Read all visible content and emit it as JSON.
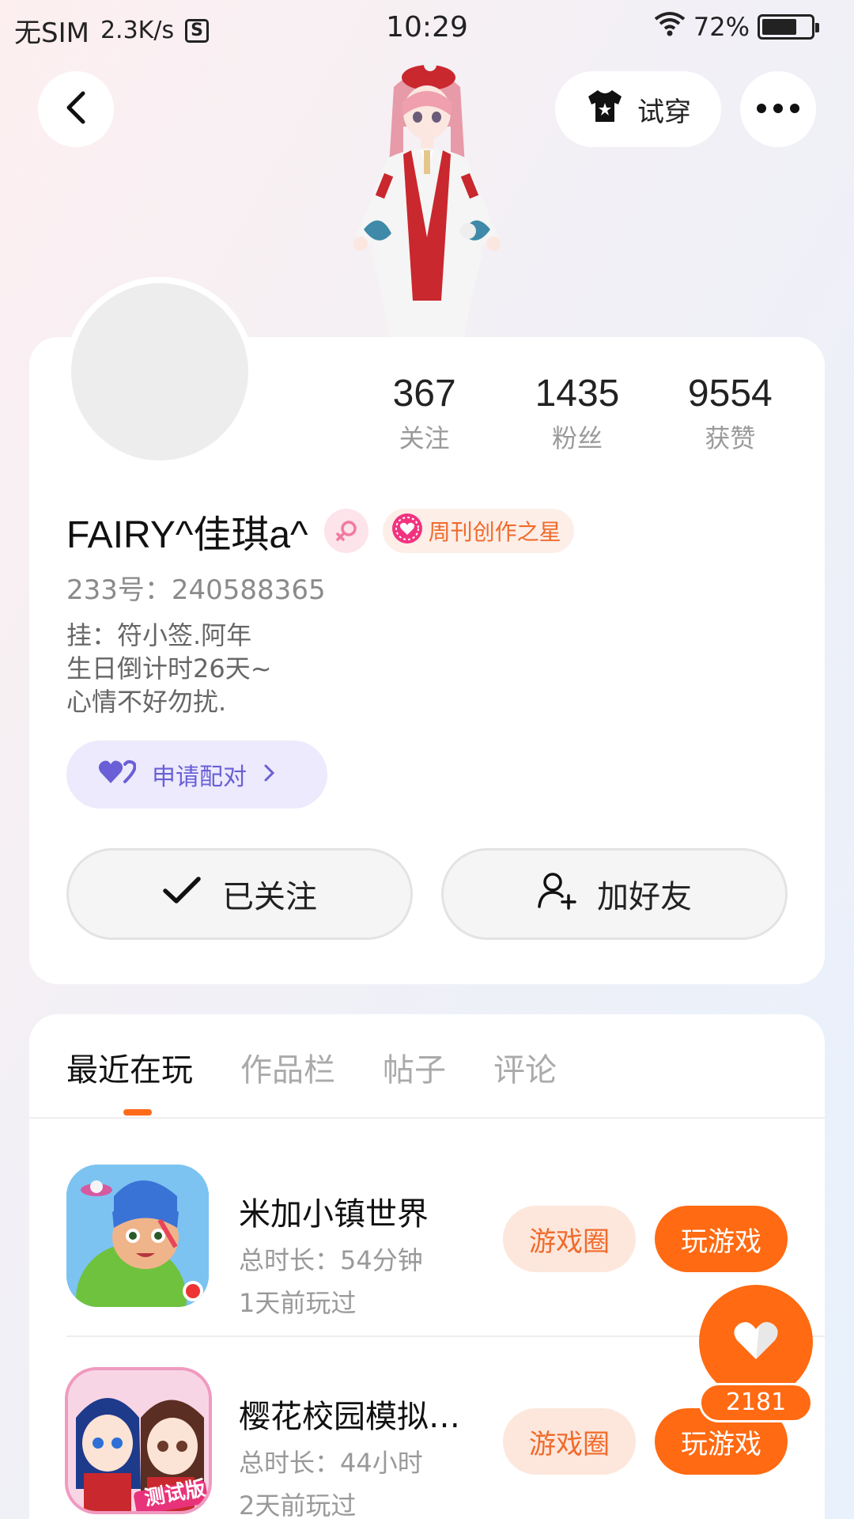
{
  "status_bar": {
    "carrier": "无SIM",
    "speed": "2.3K/s",
    "s_icon": "S",
    "time": "10:29",
    "battery": "72%",
    "battery_level": 0.72
  },
  "header": {
    "try_on_label": "试穿"
  },
  "profile": {
    "stats": [
      {
        "value": "367",
        "label": "关注"
      },
      {
        "value": "1435",
        "label": "粉丝"
      },
      {
        "value": "9554",
        "label": "获赞"
      }
    ],
    "username": "FAIRY^佳琪a^",
    "title_badge": "周刊创作之星",
    "uid": "233号：240588365",
    "bio_lines": [
      "挂：符小签.阿年",
      "生日倒计时26天~",
      "心情不好勿扰."
    ],
    "pair_label": "申请配对",
    "follow_label": "已关注",
    "add_friend_label": "加好友"
  },
  "tabs": [
    "最近在玩",
    "作品栏",
    "帖子",
    "评论"
  ],
  "games": [
    {
      "name": "米加小镇世界",
      "duration": "总时长：54分钟",
      "last_played": "1天前玩过",
      "circle_label": "游戏圈",
      "play_label": "玩游戏"
    },
    {
      "name": "樱花校园模拟…",
      "duration": "总时长：44小时",
      "last_played": "2天前玩过",
      "circle_label": "游戏圈",
      "play_label": "玩游戏",
      "icon_badge": "测试版"
    }
  ],
  "like": {
    "count": "2181"
  },
  "colors": {
    "accent": "#ff6a12",
    "pair": "#6a5fd6"
  }
}
